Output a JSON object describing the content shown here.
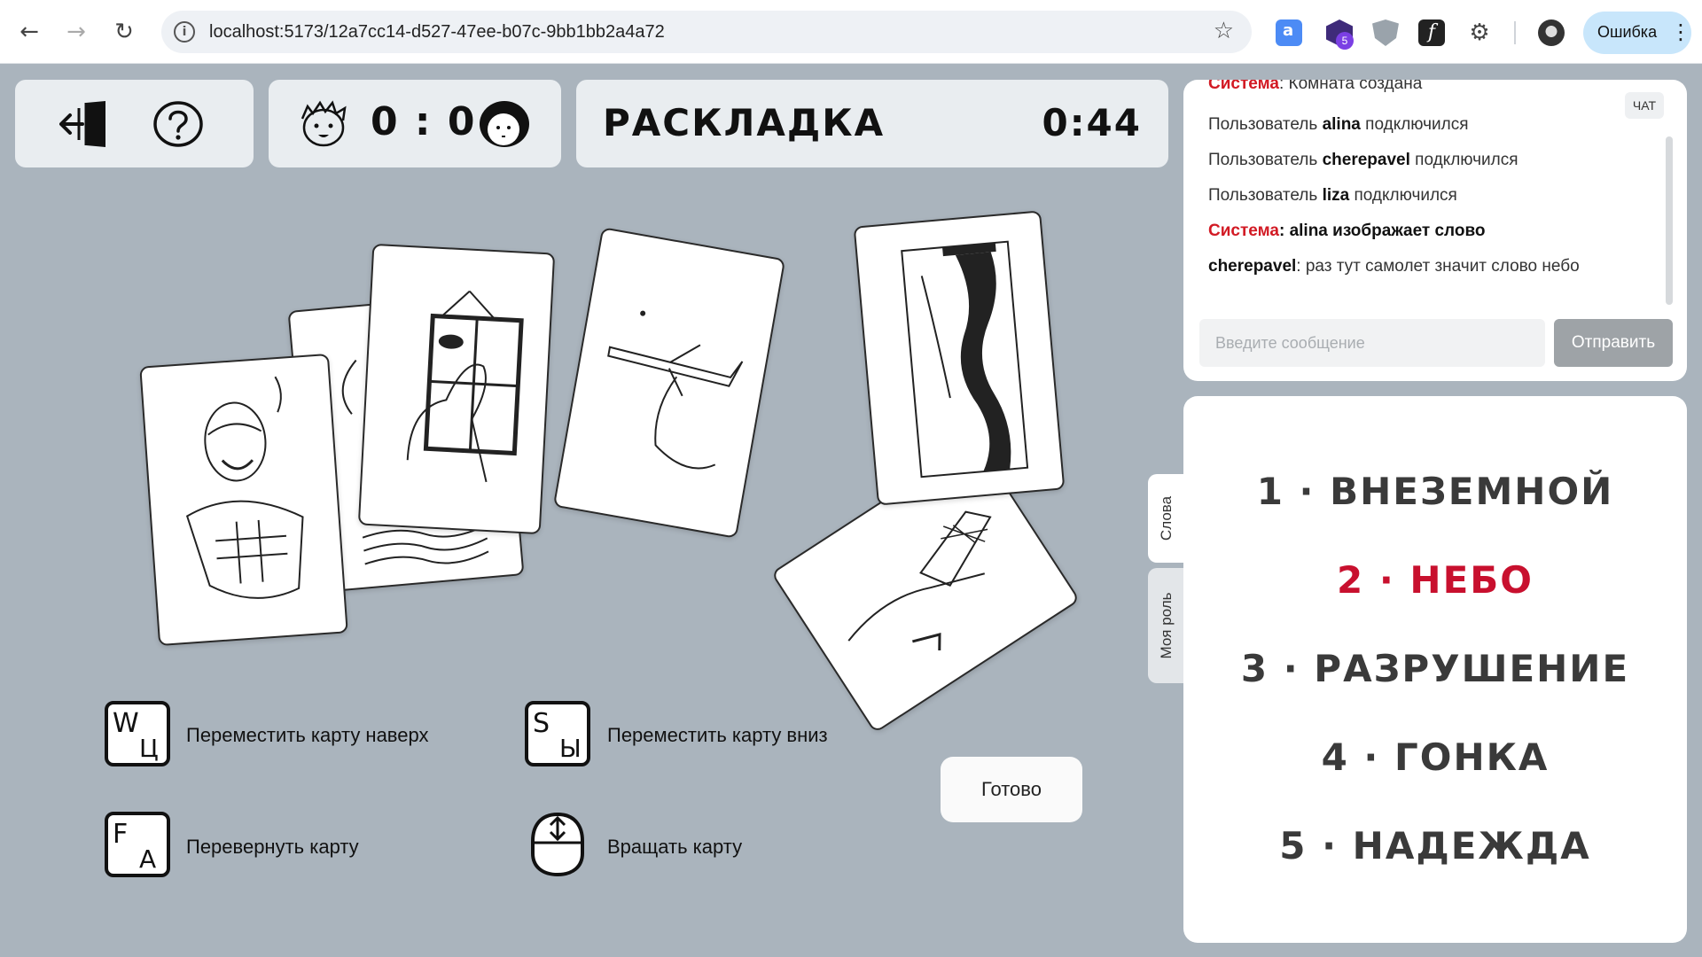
{
  "browser": {
    "url": "localhost:5173/12a7cc14-d527-47ee-b07c-9bb1bb2a4a72",
    "extension_badge": "5",
    "error_label": "Ошибка"
  },
  "header": {
    "score": "0 : 0",
    "phase_title": "РАСКЛАДКА",
    "timer": "0:44"
  },
  "chat": {
    "tag": "ЧАТ",
    "messages": [
      {
        "prefix": "Система",
        "text": ": Комната создана"
      },
      {
        "pre": "Пользователь ",
        "user": "alina",
        "post": " подключился"
      },
      {
        "pre": "Пользователь ",
        "user": "cherepavel",
        "post": " подключился"
      },
      {
        "pre": "Пользователь ",
        "user": "liza",
        "post": " подключился"
      },
      {
        "prefix": "Система",
        "text": ": alina изображает слово"
      },
      {
        "user": "cherepavel",
        "post": ": раз тут самолет значит слово небо"
      }
    ],
    "input_placeholder": "Введите сообщение",
    "send_label": "Отправить"
  },
  "side_tabs": {
    "words": "Слова",
    "role": "Моя роль"
  },
  "words": [
    {
      "label": "1 · ВНЕЗЕМНОЙ",
      "secret": false
    },
    {
      "label": "2 · НЕБО",
      "secret": true
    },
    {
      "label": "3 · РАЗРУШЕНИЕ",
      "secret": false
    },
    {
      "label": "4 · ГОНКА",
      "secret": false
    },
    {
      "label": "5 · НАДЕЖДА",
      "secret": false
    }
  ],
  "hints": {
    "move_up": "Переместить карту наверх",
    "move_down": "Переместить карту вниз",
    "flip": "Перевернуть карту",
    "rotate": "Вращать карту",
    "key_w": "W",
    "key_w_ru": "Ц",
    "key_s": "S",
    "key_s_ru": "Ы",
    "key_f": "F",
    "key_f_ru": "А"
  },
  "done_label": "Готово",
  "colors": {
    "background": "#aab4bd",
    "panel": "#e9edf0",
    "secret_word": "#c8102e",
    "system_name": "#d21a24"
  }
}
